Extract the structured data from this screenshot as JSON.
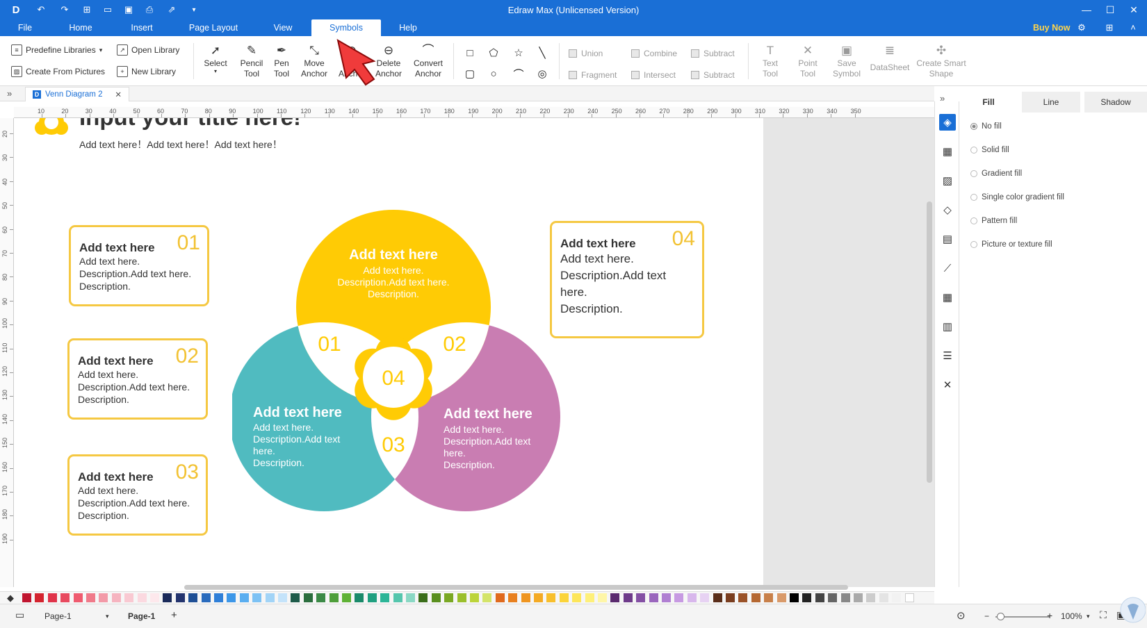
{
  "app": {
    "title": "Edraw Max (Unlicensed Version)"
  },
  "menu": {
    "tabs": [
      {
        "label": "File"
      },
      {
        "label": "Home"
      },
      {
        "label": "Insert"
      },
      {
        "label": "Page Layout"
      },
      {
        "label": "View"
      },
      {
        "label": "Symbols"
      },
      {
        "label": "Help"
      }
    ],
    "active_tab": "Symbols",
    "buy_now": "Buy Now"
  },
  "ribbon": {
    "library": {
      "predefine": "Predefine Libraries",
      "open": "Open Library",
      "from_pictures": "Create From Pictures",
      "new": "New Library"
    },
    "tools": [
      {
        "icon": "select-arrow-icon",
        "label": "Select"
      },
      {
        "icon": "pencil-icon",
        "label": "Pencil Tool"
      },
      {
        "icon": "pen-icon",
        "label": "Pen Tool"
      },
      {
        "icon": "move-anchor-icon",
        "label": "Move Anchor"
      },
      {
        "icon": "add-anchor-icon",
        "label": "Add Anchor"
      },
      {
        "icon": "delete-anchor-icon",
        "label": "Delete Anchor"
      },
      {
        "icon": "convert-anchor-icon",
        "label": "Convert Anchor"
      }
    ],
    "boolean": {
      "union": "Union",
      "combine": "Combine",
      "subtract": "Subtract",
      "fragment": "Fragment",
      "intersect": "Intersect",
      "subtract2": "Subtract"
    },
    "disabled_tools": [
      {
        "icon": "text-tool-icon",
        "label": "Text Tool"
      },
      {
        "icon": "point-tool-icon",
        "label": "Point Tool"
      },
      {
        "icon": "save-symbol-icon",
        "label": "Save Symbol"
      },
      {
        "icon": "datasheet-icon",
        "label": "DataSheet"
      },
      {
        "icon": "smart-shape-icon",
        "label": "Create Smart Shape"
      }
    ]
  },
  "document": {
    "tab_name": "Venn Diagram 2"
  },
  "ruler": {
    "h_labels": [
      "10",
      "20",
      "30",
      "40",
      "50",
      "60",
      "70",
      "80",
      "90",
      "100",
      "110",
      "120",
      "130",
      "140",
      "150",
      "160",
      "170",
      "180",
      "190",
      "200",
      "210",
      "220",
      "230",
      "240",
      "250",
      "260",
      "270",
      "280",
      "290",
      "300",
      "310",
      "320",
      "330",
      "340",
      "350"
    ],
    "v_labels": [
      "20",
      "30",
      "40",
      "50",
      "60",
      "70",
      "80",
      "90",
      "100",
      "110",
      "120",
      "130",
      "140",
      "150",
      "160",
      "170",
      "180",
      "190"
    ]
  },
  "diagram": {
    "title": "Input your title here!",
    "subtitle": "Add text here！Add text here！Add text here！",
    "venn": {
      "top": {
        "heading": "Add text here",
        "lines": [
          "Add text here.",
          "Description.Add text here.",
          "Description."
        ],
        "color": "#ffcb05"
      },
      "left": {
        "heading": "Add text here",
        "lines": [
          "Add text here.",
          "Description.Add text",
          "here.",
          "Description."
        ],
        "color": "#50bbc0"
      },
      "right": {
        "heading": "Add text here",
        "lines": [
          "Add text here.",
          "Description.Add text",
          "here.",
          "Description."
        ],
        "color": "#c97db2"
      },
      "numbers": {
        "n01": "01",
        "n02": "02",
        "n03": "03",
        "n04": "04"
      }
    },
    "boxes": [
      {
        "heading": "Add text here",
        "lines": [
          "Add text here.",
          "Description.Add text here.",
          "Description."
        ],
        "num": "01"
      },
      {
        "heading": "Add text here",
        "lines": [
          "Add text here.",
          "Description.Add text here.",
          "Description."
        ],
        "num": "02"
      },
      {
        "heading": "Add text here",
        "lines": [
          "Add text here.",
          "Description.Add text here.",
          "Description."
        ],
        "num": "03"
      },
      {
        "heading": "Add text here",
        "lines": [
          "Add text here.",
          "Description.Add text",
          "here.",
          "Description."
        ],
        "num": "04"
      }
    ],
    "accent": "#f5c842"
  },
  "right_panel": {
    "tabs": [
      {
        "label": "Fill"
      },
      {
        "label": "Line"
      },
      {
        "label": "Shadow"
      }
    ],
    "active_tab": "Fill",
    "fill_options": [
      {
        "label": "No fill",
        "selected": true
      },
      {
        "label": "Solid fill",
        "selected": false
      },
      {
        "label": "Gradient fill",
        "selected": false
      },
      {
        "label": "Single color gradient fill",
        "selected": false
      },
      {
        "label": "Pattern fill",
        "selected": false
      },
      {
        "label": "Picture or texture fill",
        "selected": false
      }
    ]
  },
  "palette": [
    "#c0152f",
    "#d4242f",
    "#e0334a",
    "#e84a5f",
    "#ef5b6f",
    "#f07a8a",
    "#f39aa8",
    "#f6b4c0",
    "#f9c9d2",
    "#fbd9e0",
    "#fde8ec",
    "#1a2a5a",
    "#24346e",
    "#1f4f95",
    "#2a6bbd",
    "#2f7fd8",
    "#3d97e8",
    "#5aaef0",
    "#7dc2f4",
    "#a2d4f7",
    "#c4e3fa",
    "#1e5b4a",
    "#2b6e3e",
    "#3c8a47",
    "#4e9e3a",
    "#5fb236",
    "#1a8a6a",
    "#20a080",
    "#2cb597",
    "#55c6ad",
    "#8ad8c4",
    "#3a6d1a",
    "#5a8f1f",
    "#7aa824",
    "#9bbf2c",
    "#bcd43a",
    "#d4e46a",
    "#e06a1e",
    "#e8801f",
    "#ef9520",
    "#f4aa24",
    "#f8bf2c",
    "#fbd43a",
    "#fde65a",
    "#fef07a",
    "#fef6a8",
    "#5a2a6e",
    "#6e3b8a",
    "#8450a4",
    "#9a66bd",
    "#b07fd2",
    "#c79ae2",
    "#d8b7ec",
    "#e7d2f3",
    "#5a2e1a",
    "#7a3e20",
    "#9a5228",
    "#b56832",
    "#c8804a",
    "#d99a6a",
    "#000000",
    "#222222",
    "#444444",
    "#666666",
    "#888888",
    "#aaaaaa",
    "#cccccc",
    "#e4e4e4",
    "#f2f2f2",
    "#ffffff"
  ],
  "status": {
    "page_dropdown": "Page-1",
    "page_tab": "Page-1",
    "zoom": "100%"
  }
}
